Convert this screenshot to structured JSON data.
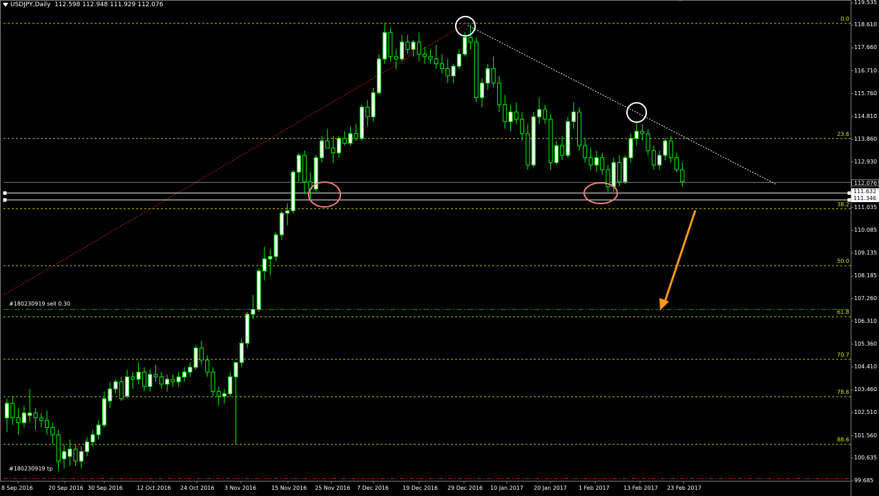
{
  "header": {
    "symbol": "USDJPY,Daily",
    "ohlc": "112.598 112.948 111.929 112.076"
  },
  "colors": {
    "background": "#000000",
    "bull_candle": "#ffffff",
    "bear_candle": "#000000",
    "candle_wick": "#00ff00",
    "fib_level": "#c8c800",
    "fib_label": "#e0e000",
    "fib_line": "#cc2222",
    "trendline": "#ffffff",
    "arrow": "#ff9a1a",
    "order_line": "#10a010",
    "tp_line": "#c0c0c0",
    "circle_top": "#ffffff",
    "circle_bottom": "#f08080"
  },
  "price_axis": {
    "ticks": [
      "119.535",
      "118.610",
      "117.660",
      "116.710",
      "115.760",
      "114.810",
      "113.860",
      "112.930",
      "112.076",
      "111.632",
      "111.346",
      "111.035",
      "110.085",
      "109.135",
      "108.185",
      "107.260",
      "106.310",
      "105.360",
      "104.410",
      "103.460",
      "102.510",
      "101.560",
      "100.635",
      "99.685"
    ],
    "tick_values": [
      119.535,
      118.61,
      117.66,
      116.71,
      115.76,
      114.81,
      113.86,
      112.93,
      111.035,
      110.085,
      109.135,
      108.185,
      107.26,
      106.31,
      105.36,
      104.41,
      103.46,
      102.51,
      101.56,
      100.635,
      99.685
    ],
    "tick_labels": [
      "119.535",
      "118.610",
      "117.660",
      "116.710",
      "115.760",
      "114.810",
      "113.860",
      "112.930",
      "111.035",
      "110.085",
      "109.135",
      "108.185",
      "107.260",
      "106.310",
      "105.360",
      "104.410",
      "103.460",
      "102.510",
      "101.560",
      "100.635",
      "99.685"
    ],
    "current_price": "112.076",
    "hline_1": "111.632",
    "hline_2": "111.346"
  },
  "date_axis": {
    "labels": [
      "8 Sep 2016",
      "20 Sep 2016",
      "30 Sep 2016",
      "12 Oct 2016",
      "24 Oct 2016",
      "3 Nov 2016",
      "15 Nov 2016",
      "25 Nov 2016",
      "7 Dec 2016",
      "19 Dec 2016",
      "29 Dec 2016",
      "10 Jan 2017",
      "20 Jan 2017",
      "1 Feb 2017",
      "13 Feb 2017",
      "23 Feb 2017"
    ]
  },
  "fib_levels": [
    {
      "label": "0.0",
      "price": 118.68
    },
    {
      "label": "23.6",
      "price": 113.9
    },
    {
      "label": "38.2",
      "price": 110.98
    },
    {
      "label": "50.0",
      "price": 108.62
    },
    {
      "label": "61.8",
      "price": 106.5
    },
    {
      "label": "70.7",
      "price": 104.73
    },
    {
      "label": "78.6",
      "price": 103.18
    },
    {
      "label": "88.6",
      "price": 101.2
    }
  ],
  "orders": {
    "sell_label": "#180230919 sell 0.30",
    "sell_price": 106.8,
    "tp_label": "#180230919 tp",
    "tp_price": 99.78
  },
  "chart_data": {
    "type": "candlestick",
    "symbol": "USDJPY",
    "timeframe": "Daily",
    "xlabel": "",
    "ylabel": "",
    "ylim": [
      99.685,
      119.535
    ],
    "candles": [
      [
        102.3,
        103.1,
        101.7,
        102.9
      ],
      [
        102.9,
        103.2,
        102.0,
        102.3
      ],
      [
        102.3,
        102.7,
        101.6,
        102.1
      ],
      [
        102.1,
        102.8,
        101.9,
        102.5
      ],
      [
        102.4,
        103.5,
        102.1,
        102.5
      ],
      [
        102.5,
        102.7,
        101.8,
        102.3
      ],
      [
        102.3,
        102.5,
        101.9,
        102.2
      ],
      [
        102.2,
        102.6,
        101.6,
        101.9
      ],
      [
        101.9,
        102.1,
        101.2,
        101.6
      ],
      [
        101.6,
        101.8,
        100.1,
        100.5
      ],
      [
        100.6,
        101.2,
        100.2,
        100.9
      ],
      [
        100.7,
        101.4,
        100.3,
        101.0
      ],
      [
        101.0,
        101.2,
        100.3,
        100.5
      ],
      [
        100.5,
        101.1,
        100.2,
        100.9
      ],
      [
        100.9,
        101.5,
        100.7,
        101.3
      ],
      [
        101.3,
        101.8,
        101.1,
        101.6
      ],
      [
        101.6,
        102.2,
        101.4,
        102.0
      ],
      [
        102.0,
        103.4,
        101.9,
        103.1
      ],
      [
        103.0,
        103.8,
        102.7,
        103.5
      ],
      [
        103.5,
        103.9,
        103.3,
        103.8
      ],
      [
        103.8,
        104.0,
        103.0,
        103.1
      ],
      [
        103.2,
        104.3,
        103.1,
        104.0
      ],
      [
        104.0,
        104.2,
        103.5,
        103.9
      ],
      [
        103.9,
        104.6,
        103.7,
        104.2
      ],
      [
        104.2,
        104.4,
        103.4,
        103.6
      ],
      [
        103.6,
        104.3,
        103.4,
        104.1
      ],
      [
        104.1,
        104.5,
        103.8,
        104.0
      ],
      [
        104.0,
        104.2,
        103.5,
        103.7
      ],
      [
        103.7,
        104.1,
        103.4,
        103.9
      ],
      [
        103.9,
        104.1,
        103.6,
        103.8
      ],
      [
        103.8,
        104.2,
        103.6,
        104.0
      ],
      [
        104.0,
        104.4,
        103.8,
        104.2
      ],
      [
        104.2,
        104.6,
        104.0,
        104.4
      ],
      [
        104.4,
        105.3,
        104.3,
        105.2
      ],
      [
        105.2,
        105.5,
        104.5,
        104.7
      ],
      [
        104.7,
        104.9,
        104.0,
        104.2
      ],
      [
        104.2,
        104.4,
        103.2,
        103.4
      ],
      [
        103.4,
        103.6,
        102.8,
        103.2
      ],
      [
        103.2,
        103.5,
        102.9,
        103.3
      ],
      [
        103.3,
        104.2,
        103.2,
        104.0
      ],
      [
        104.0,
        104.6,
        101.2,
        104.6
      ],
      [
        104.6,
        105.6,
        104.4,
        105.4
      ],
      [
        105.4,
        106.7,
        105.2,
        106.6
      ],
      [
        106.6,
        107.4,
        106.4,
        106.8
      ],
      [
        106.8,
        108.5,
        106.7,
        108.4
      ],
      [
        108.4,
        109.4,
        108.0,
        108.9
      ],
      [
        108.9,
        109.3,
        108.2,
        109.0
      ],
      [
        109.0,
        110.0,
        108.8,
        109.9
      ],
      [
        109.9,
        110.9,
        109.7,
        110.8
      ],
      [
        110.8,
        111.2,
        110.3,
        110.9
      ],
      [
        110.9,
        112.6,
        110.8,
        112.5
      ],
      [
        112.5,
        113.3,
        112.1,
        113.2
      ],
      [
        113.2,
        113.4,
        111.6,
        112.1
      ],
      [
        112.1,
        112.5,
        111.3,
        111.8
      ],
      [
        111.8,
        113.2,
        111.7,
        113.1
      ],
      [
        113.1,
        114.0,
        112.9,
        113.8
      ],
      [
        113.8,
        114.3,
        113.5,
        113.5
      ],
      [
        113.5,
        114.0,
        112.9,
        113.3
      ],
      [
        113.3,
        114.0,
        113.1,
        113.9
      ],
      [
        113.9,
        114.2,
        113.6,
        113.7
      ],
      [
        113.7,
        114.4,
        113.6,
        114.1
      ],
      [
        114.1,
        114.5,
        113.8,
        113.9
      ],
      [
        113.9,
        115.3,
        113.8,
        115.2
      ],
      [
        115.2,
        115.5,
        114.4,
        114.8
      ],
      [
        114.8,
        116.0,
        114.6,
        115.8
      ],
      [
        115.8,
        117.4,
        115.7,
        117.2
      ],
      [
        117.2,
        118.7,
        117.0,
        118.3
      ],
      [
        118.3,
        118.5,
        117.1,
        117.3
      ],
      [
        117.3,
        117.6,
        116.8,
        117.2
      ],
      [
        117.2,
        118.2,
        117.1,
        117.9
      ],
      [
        117.9,
        118.2,
        117.4,
        117.6
      ],
      [
        117.6,
        118.0,
        117.3,
        117.9
      ],
      [
        117.9,
        118.3,
        117.1,
        117.4
      ],
      [
        117.4,
        117.7,
        117.0,
        117.3
      ],
      [
        117.3,
        117.6,
        117.0,
        117.2
      ],
      [
        117.2,
        117.8,
        116.8,
        117.0
      ],
      [
        117.0,
        117.4,
        116.6,
        116.8
      ],
      [
        116.8,
        117.2,
        116.2,
        116.5
      ],
      [
        116.5,
        117.0,
        116.2,
        116.9
      ],
      [
        116.9,
        117.6,
        116.8,
        117.4
      ],
      [
        117.4,
        118.3,
        117.3,
        118.1
      ],
      [
        118.1,
        118.6,
        117.6,
        117.9
      ],
      [
        117.9,
        118.1,
        115.4,
        115.6
      ],
      [
        115.6,
        116.4,
        115.2,
        116.2
      ],
      [
        116.2,
        117.0,
        115.9,
        116.8
      ],
      [
        116.8,
        117.3,
        116.0,
        116.2
      ],
      [
        116.2,
        116.5,
        115.0,
        115.3
      ],
      [
        115.3,
        115.7,
        114.3,
        114.6
      ],
      [
        114.6,
        115.3,
        114.2,
        115.0
      ],
      [
        115.0,
        115.4,
        114.5,
        114.7
      ],
      [
        114.7,
        115.0,
        113.8,
        114.1
      ],
      [
        114.1,
        114.5,
        112.6,
        112.8
      ],
      [
        112.8,
        115.0,
        112.7,
        114.8
      ],
      [
        114.8,
        115.6,
        114.5,
        115.1
      ],
      [
        115.1,
        115.3,
        114.5,
        114.7
      ],
      [
        114.7,
        114.9,
        112.6,
        112.9
      ],
      [
        112.9,
        113.8,
        112.8,
        113.6
      ],
      [
        113.6,
        114.0,
        113.0,
        113.2
      ],
      [
        113.2,
        114.8,
        113.1,
        114.6
      ],
      [
        114.6,
        115.4,
        114.3,
        115.0
      ],
      [
        115.0,
        115.2,
        113.4,
        113.6
      ],
      [
        113.6,
        113.9,
        112.9,
        113.1
      ],
      [
        113.1,
        113.5,
        112.6,
        112.8
      ],
      [
        112.8,
        113.4,
        112.5,
        113.1
      ],
      [
        113.1,
        113.3,
        112.4,
        112.6
      ],
      [
        112.6,
        112.8,
        111.7,
        111.9
      ],
      [
        111.9,
        113.1,
        111.7,
        112.9
      ],
      [
        112.9,
        113.2,
        111.9,
        112.1
      ],
      [
        112.1,
        113.2,
        112.0,
        113.1
      ],
      [
        113.1,
        114.1,
        112.9,
        113.9
      ],
      [
        113.9,
        114.6,
        113.6,
        114.2
      ],
      [
        114.2,
        114.5,
        113.8,
        114.1
      ],
      [
        114.1,
        114.3,
        113.2,
        113.4
      ],
      [
        113.4,
        113.6,
        112.6,
        112.8
      ],
      [
        112.8,
        113.4,
        112.6,
        113.2
      ],
      [
        113.2,
        113.9,
        113.0,
        113.8
      ],
      [
        113.8,
        114.0,
        112.9,
        113.1
      ],
      [
        113.1,
        113.3,
        112.5,
        112.6
      ],
      [
        112.6,
        112.9,
        111.9,
        112.1
      ]
    ]
  }
}
